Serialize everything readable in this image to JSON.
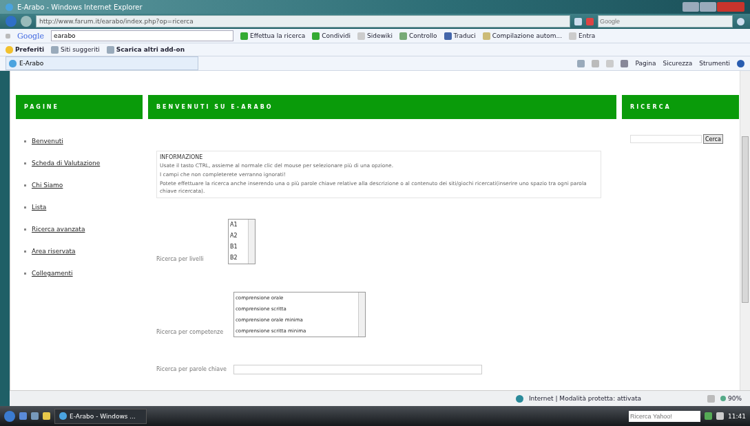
{
  "window": {
    "title": "E-Arabo - Windows Internet Explorer"
  },
  "address_bar": {
    "url": "http://www.farum.it/earabo/index.php?op=ricerca",
    "search_placeholder": "Google"
  },
  "google_toolbar": {
    "logo": "Google",
    "query": "earabo",
    "buttons": [
      "Effettua la ricerca",
      "Condividi",
      "Sidewiki",
      "Controllo",
      "Traduci",
      "Compilazione autom...",
      "Entra"
    ]
  },
  "favorites_bar": {
    "label": "Preferiti",
    "items": [
      "Siti suggeriti",
      "Scarica altri add-on"
    ]
  },
  "tabs": [
    {
      "title": "E-Arabo",
      "selected": true
    }
  ],
  "command_bar": [
    "Pagina",
    "Sicurezza",
    "Strumenti"
  ],
  "page": {
    "left": {
      "heading": "PAGINE",
      "links": [
        "Benvenuti",
        "Scheda di Valutazione",
        "Chi Siamo",
        "Lista",
        "Ricerca avanzata",
        "Area riservata",
        "Collegamenti"
      ]
    },
    "main": {
      "heading": "BENVENUTI SU E-ARABO",
      "info": {
        "title": "INFORMAZIONE",
        "lines": [
          "Usate il tasto CTRL, assieme al normale clic del mouse per selezionare più di una opzione.",
          "I campi che non completerete verranno ignorati!",
          "Potete effettuare la ricerca anche inserendo una o più parole chiave relative alla descrizione o al contenuto dei siti/giochi ricercati(inserire uno spazio tra ogni parola chiave ricercata)."
        ]
      },
      "fields": [
        {
          "kind": "listbox",
          "label": "Ricerca per livelli",
          "options": [
            "A1",
            "A2",
            "B1",
            "B2"
          ]
        },
        {
          "kind": "listbox",
          "label": "Ricerca per competenze",
          "options": [
            "comprensione orale",
            "comprensione scritta",
            "comprensione orale minima",
            "comprensione scritta minima"
          ]
        },
        {
          "kind": "text",
          "label": "Ricerca per parole chiave"
        }
      ]
    },
    "right": {
      "heading": "RICERCA",
      "button": "Cerca"
    }
  },
  "status_bar": {
    "zone": "Internet | Modalità protetta: attivata",
    "zoom": "90%"
  },
  "taskbar": {
    "tasks": [
      "E-Arabo - Windows ..."
    ],
    "search_placeholder": "Ricerca Yahoo!",
    "clock": "11:41"
  }
}
